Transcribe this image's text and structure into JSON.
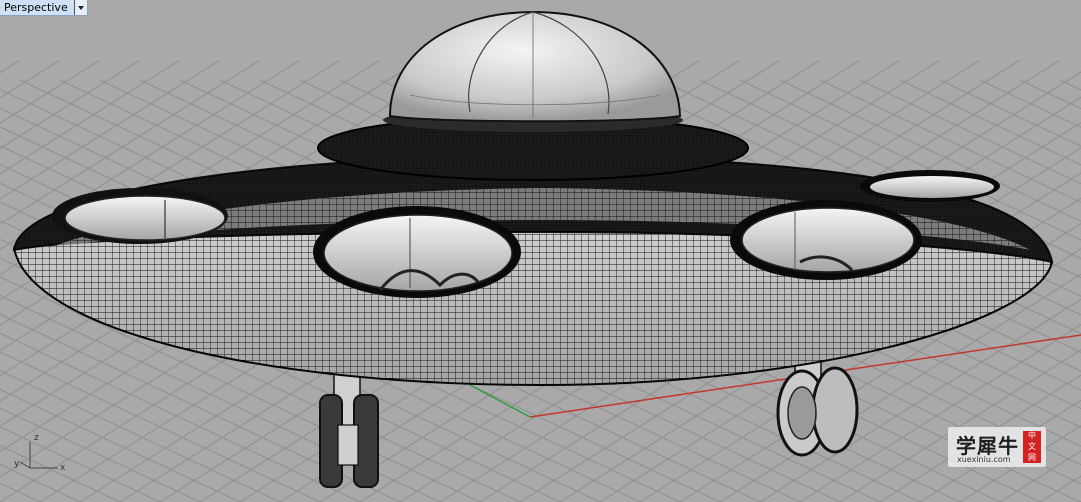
{
  "viewport": {
    "title": "Perspective"
  },
  "axis_widget": {
    "z": "z",
    "y": "y",
    "x": "x"
  },
  "watermark": {
    "brand": "学犀牛",
    "site": "xuexiniu.com",
    "seal": [
      "中",
      "文",
      "网"
    ]
  },
  "colors": {
    "background": "#a9a9a9",
    "grid": "#8f8f8f",
    "x_axis": "#c0392b",
    "y_axis": "#2e9e3f",
    "wire": "#0d0d0d",
    "surface": "#d6d6d6"
  }
}
